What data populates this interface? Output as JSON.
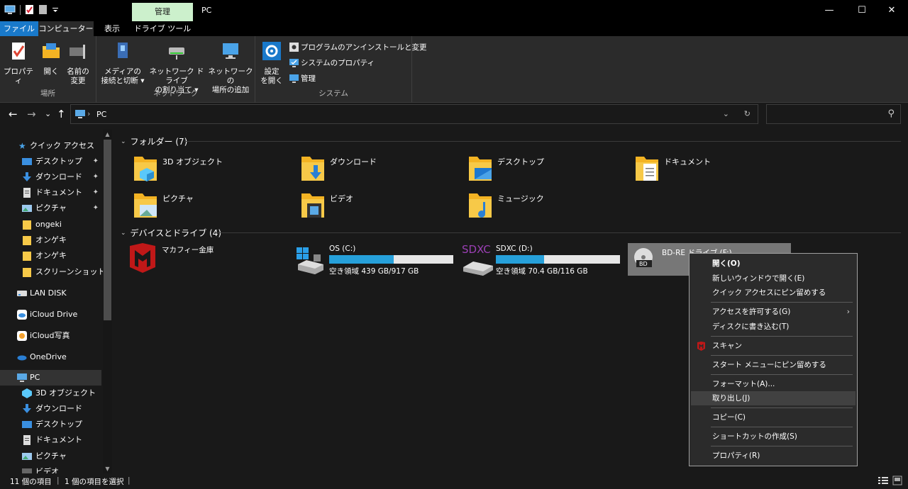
{
  "window": {
    "context_tab": "管理",
    "title": "PC",
    "minimize": "—",
    "maximize": "☐",
    "close": "✕"
  },
  "ribbon_tabs": {
    "file": "ファイル",
    "computer": "コンピューター",
    "view": "表示",
    "drive_tools": "ドライブ ツール",
    "collapse": "⌃",
    "help": "?"
  },
  "ribbon": {
    "location_group": "場所",
    "properties": "プロパティ",
    "open": "開く",
    "rename_line1": "名前の",
    "rename_line2": "変更",
    "network_group": "ネットワーク",
    "media_line1": "メディアの",
    "media_line2": "接続と切断 ▾",
    "netdrive_line1": "ネットワーク ドライブ",
    "netdrive_line2": "の割り当て ▾",
    "netloc_line1": "ネットワークの",
    "netloc_line2": "場所の追加",
    "system_group": "システム",
    "settings_line1": "設定",
    "settings_line2": "を開く",
    "uninstall": "プログラムのアンインストールと変更",
    "system_props": "システムのプロパティ",
    "manage": "管理"
  },
  "nav": {
    "back": "←",
    "forward": "→",
    "recent": "⌄",
    "up": "↑",
    "address": "PC",
    "address_sep": "›",
    "dropdown": "⌄",
    "refresh": "↻",
    "search_placeholder": "",
    "search_icon": "⚲"
  },
  "sidebar": {
    "quick_access": "クイック アクセス",
    "items": [
      {
        "label": "デスクトップ",
        "icon": "desktop-icon",
        "pinned": true
      },
      {
        "label": "ダウンロード",
        "icon": "download-icon",
        "pinned": true
      },
      {
        "label": "ドキュメント",
        "icon": "document-icon",
        "pinned": true
      },
      {
        "label": "ピクチャ",
        "icon": "picture-icon",
        "pinned": true
      },
      {
        "label": "ongeki",
        "icon": "folder-icon",
        "pinned": false
      },
      {
        "label": "オンゲキ",
        "icon": "folder-icon",
        "pinned": false
      },
      {
        "label": "オンゲキ",
        "icon": "folder-icon",
        "pinned": false
      },
      {
        "label": "スクリーンショット",
        "icon": "folder-icon",
        "pinned": false
      }
    ],
    "lan_disk": "LAN DISK",
    "icloud_drive": "iCloud Drive",
    "icloud_photos": "iCloud写真",
    "onedrive": "OneDrive",
    "pc": "PC",
    "pc_items": [
      "3D オブジェクト",
      "ダウンロード",
      "デスクトップ",
      "ドキュメント",
      "ピクチャ",
      "ビデオ"
    ],
    "pin_glyph": "📌"
  },
  "main": {
    "folders_header": "フォルダー (7)",
    "folders": [
      "3D オブジェクト",
      "ダウンロード",
      "デスクトップ",
      "ドキュメント",
      "ピクチャ",
      "ビデオ",
      "ミュージック"
    ],
    "devices_header": "デバイスとドライブ (4)",
    "mcafee": "マカフィー金庫",
    "drives": [
      {
        "name": "OS (C:)",
        "free": "空き領域 439 GB/917 GB",
        "used_fraction": 0.52
      },
      {
        "name": "SDXC (D:)",
        "free": "空き領域 70.4 GB/116 GB",
        "used_fraction": 0.39
      }
    ],
    "bd_drive": "BD-RE ドライブ (F:)",
    "sdxc_logo": "SDXC",
    "bd_logo": "BD"
  },
  "context_menu": {
    "open": "開く(O)",
    "open_new_window": "新しいウィンドウで開く(E)",
    "pin_quick_access": "クイック アクセスにピン留めする",
    "give_access": "アクセスを許可する(G)",
    "burn": "ディスクに書き込む(T)",
    "scan": "スキャン",
    "pin_start": "スタート メニューにピン留めする",
    "format": "フォーマット(A)...",
    "eject": "取り出し(J)",
    "copy": "コピー(C)",
    "create_shortcut": "ショートカットの作成(S)",
    "properties": "プロパティ(R)",
    "submenu_arrow": "›"
  },
  "status": {
    "items": "11 個の項目",
    "selected": "1 個の項目を選択",
    "sep": "|"
  },
  "colors": {
    "accent": "#1979ca",
    "drive_bar": "#26a0da",
    "folder": "#f7c948",
    "mcafee": "#c01818"
  }
}
